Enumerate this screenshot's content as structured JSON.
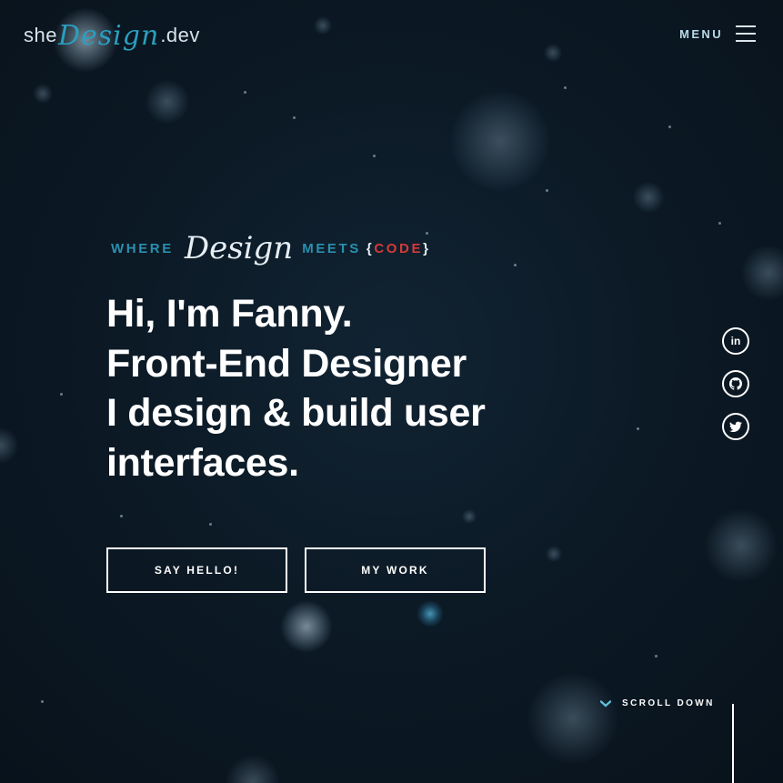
{
  "header": {
    "logo": {
      "prefix": "she",
      "script": "Design",
      "suffix": ".dev"
    },
    "menu_label": "MENU"
  },
  "hero": {
    "tagline": {
      "where": "WHERE",
      "design": "Design",
      "meets": "MEETS",
      "brace_open": "{",
      "code": "CODE",
      "brace_close": "}"
    },
    "headline": [
      "Hi, I'm Fanny.",
      "Front-End Designer",
      "I design & build user",
      "interfaces."
    ],
    "buttons": {
      "say_hello": "SAY HELLO!",
      "my_work": "MY WORK"
    }
  },
  "social": {
    "linkedin_icon": "linkedin-icon",
    "github_icon": "github-icon",
    "twitter_icon": "twitter-icon",
    "linkedin_text": "in"
  },
  "scroll": {
    "label": "SCROLL DOWN",
    "icon": "chevron-down-icon"
  },
  "colors": {
    "background": "#0c1a26",
    "accent_teal": "#2a8fae",
    "accent_red": "#d43a3a",
    "text": "#ffffff"
  }
}
